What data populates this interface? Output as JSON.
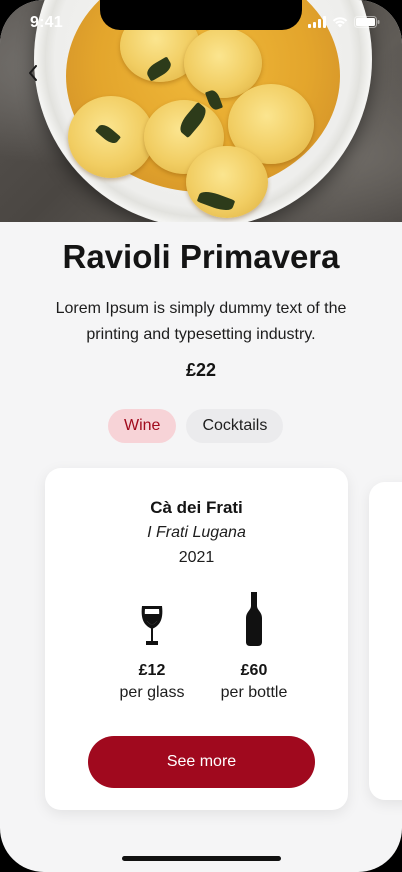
{
  "status": {
    "time": "9:41"
  },
  "icons": {
    "back": "chevron-left-icon",
    "signal": "cellular-signal-icon",
    "wifi": "wifi-icon",
    "battery": "battery-icon",
    "glass": "wine-glass-icon",
    "bottle": "wine-bottle-icon"
  },
  "dish": {
    "title": "Ravioli Primavera",
    "description": "Lorem Ipsum is simply dummy text of the printing and typesetting industry.",
    "price": "£22"
  },
  "tabs": [
    {
      "label": "Wine",
      "active": true
    },
    {
      "label": "Cocktails",
      "active": false
    }
  ],
  "wine_card": {
    "name": "Cà dei Frati",
    "producer": "I Frati Lugana",
    "year": "2021",
    "glass_price": "£12",
    "glass_unit": "per glass",
    "bottle_price": "£60",
    "bottle_unit": "per bottle",
    "cta": "See more"
  },
  "colors": {
    "accent": "#a0091e",
    "active_tab_bg": "#f7d3d7",
    "inactive_tab_bg": "#ebebed",
    "background": "#f5f5f6"
  }
}
